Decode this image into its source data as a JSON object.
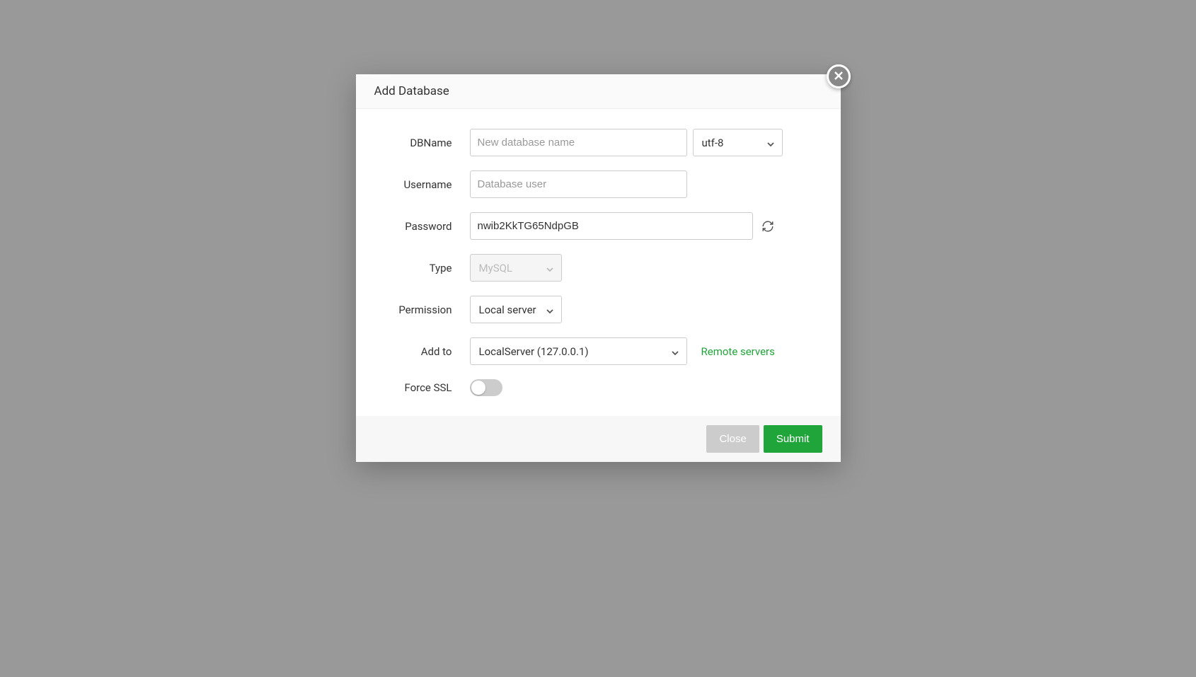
{
  "modal": {
    "title": "Add Database",
    "labels": {
      "dbname": "DBName",
      "username": "Username",
      "password": "Password",
      "type": "Type",
      "permission": "Permission",
      "addto": "Add to",
      "forcessl": "Force SSL"
    },
    "fields": {
      "dbname_placeholder": "New database name",
      "dbname_value": "",
      "charset_selected": "utf-8",
      "username_placeholder": "Database user",
      "username_value": "",
      "password_value": "nwib2KkTG65NdpGB",
      "type_selected": "MySQL",
      "permission_selected": "Local server",
      "addto_selected": "LocalServer (127.0.0.1)",
      "remote_link": "Remote servers",
      "forcessl_on": false
    },
    "footer": {
      "close": "Close",
      "submit": "Submit"
    }
  }
}
